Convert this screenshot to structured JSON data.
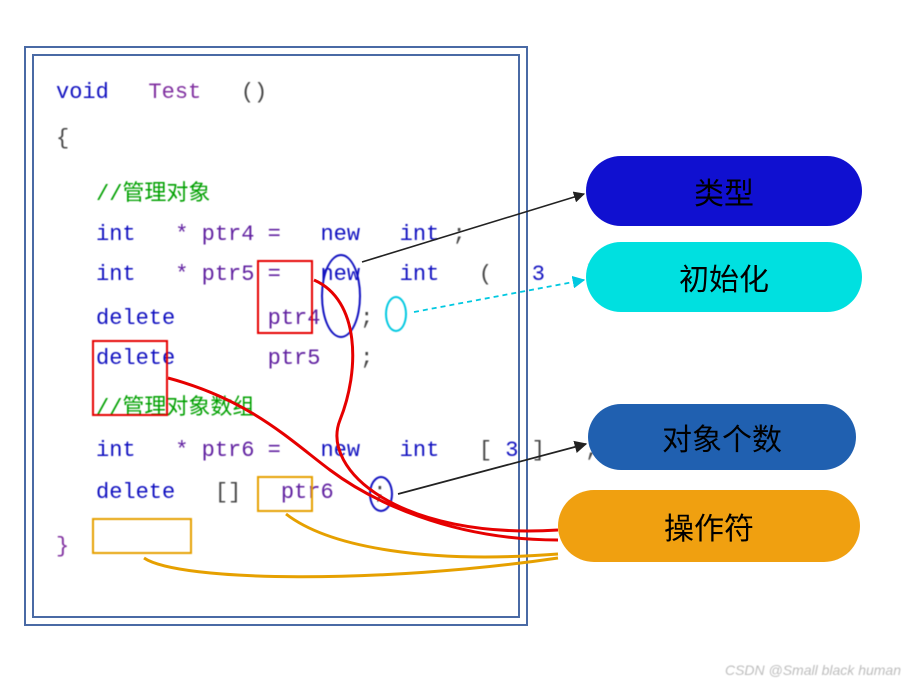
{
  "code": {
    "decl_void": "void",
    "decl_fn": "Test",
    "decl_paren": "()",
    "brace_open": "{",
    "comment1": "//管理对象",
    "line_ptr4_a": "int",
    "line_ptr4_b": "* ptr4 =",
    "line_ptr4_new": "new",
    "line_ptr4_type": "int",
    "line_ptr4_end": ";",
    "line_ptr5_a": "int",
    "line_ptr5_b": "* ptr5 =",
    "line_ptr5_new": "new",
    "line_ptr5_type": "int",
    "line_ptr5_paren_l": "(",
    "line_ptr5_num": "3",
    "line_ptr5_paren_r": ")",
    "line_ptr5_end": ";",
    "del_ptr4_kw": "delete",
    "del_ptr4_var": "ptr4",
    "del_ptr4_end": ";",
    "del_ptr5_kw": "delete",
    "del_ptr5_var": "ptr5",
    "del_ptr5_end": ";",
    "comment2": "//管理对象数组",
    "line_ptr6_a": "int",
    "line_ptr6_b": "* ptr6 =",
    "line_ptr6_new": "new",
    "line_ptr6_type": "int",
    "line_ptr6_br_l": "[",
    "line_ptr6_num": "3",
    "line_ptr6_br_r": "]",
    "line_ptr6_end": ";",
    "del_ptr6_kw": "delete",
    "del_ptr6_br": "[]",
    "del_ptr6_var": "ptr6",
    "del_ptr6_end": ";",
    "brace_close": "}"
  },
  "labels": {
    "type": "类型",
    "init": "初始化",
    "count": "对象个数",
    "operator": "操作符"
  },
  "watermark": "CSDN @Small black human"
}
